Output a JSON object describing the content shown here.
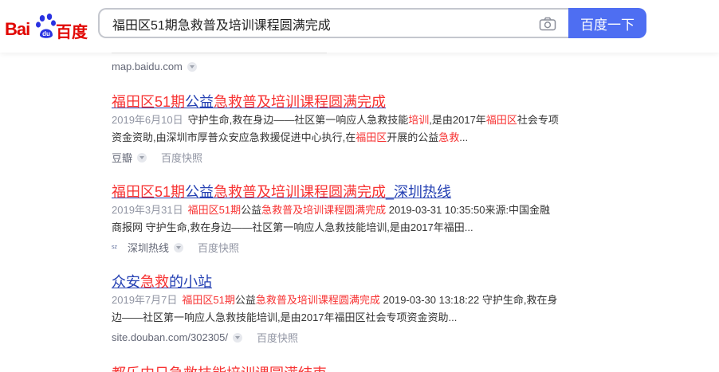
{
  "header": {
    "logo_bai": "Bai",
    "logo_cn": "百度",
    "search_value": "福田区51期急救普及培训课程圆满完成",
    "search_button": "百度一下"
  },
  "results": [
    {
      "source": "map.baidu.com"
    },
    {
      "title_parts": [
        "福田区51期",
        "公益",
        "急救普及培训课程圆满完成"
      ],
      "date": "2019年6月10日",
      "abs_line1": [
        "守护生命,救在身边——社区第一响应人急救技能",
        "培训",
        ",是由2017年",
        "福田区",
        "社会专项"
      ],
      "abs_line2": [
        "资金资助,由深圳市厚普众安应急救援促进中心执行,在",
        "福田区",
        "开展的公益",
        "急救",
        "..."
      ],
      "source": "豆瓣",
      "snapshot": "百度快照"
    },
    {
      "title_parts": [
        "福田区51期",
        "公益",
        "急救普及培训课程圆满完成",
        "_深圳热线"
      ],
      "date": "2019年3月31日",
      "abs_line1": [
        "福田区51期",
        "公益",
        "急救普及培训课程圆满完成",
        " 2019-03-31 10:35:50来源:中国金融"
      ],
      "abs_line2": "商报网 守护生命,救在身边——社区第一响应人急救技能培训,是由2017年福田...",
      "source": "深圳热线",
      "favicon": "sz",
      "snapshot": "百度快照"
    },
    {
      "title_parts": [
        "众安",
        "急救",
        "的小站"
      ],
      "date": "2019年7月7日",
      "abs_line1": [
        "福田区51期",
        "公益",
        "急救普及培训课程圆满完成",
        " 2019-03-30 13:18:22 守护生命,救在身"
      ],
      "abs_line2": "边——社区第一响应人急救技能培训,是由2017年福田区社会专项资金资助...",
      "source": "site.douban.com/302305/",
      "snapshot": "百度快照"
    }
  ],
  "bottom_partial": "都乐中日急救技能培训课圆满结束"
}
